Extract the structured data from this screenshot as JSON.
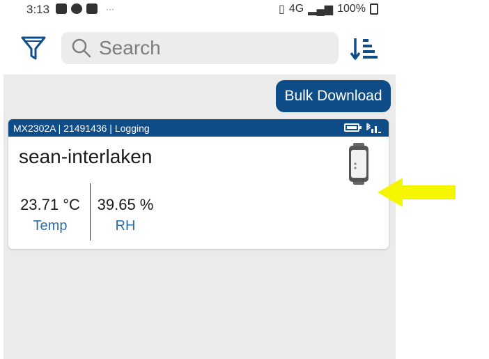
{
  "status_bar": {
    "time": "3:13",
    "network": "4G",
    "battery": "100%"
  },
  "search": {
    "placeholder": "Search"
  },
  "actions": {
    "bulk_download": "Bulk Download"
  },
  "device_card": {
    "header": "MX2302A | 21491436 | Logging",
    "name": "sean-interlaken",
    "readings": [
      {
        "value": "23.71 °C",
        "label": "Temp"
      },
      {
        "value": "39.65 %",
        "label": "RH"
      }
    ]
  },
  "colors": {
    "brand_blue": "#0f4d88",
    "label_blue": "#2f6ea5",
    "annotation_arrow": "#f5f500"
  },
  "icons": [
    "filter-icon",
    "search-icon",
    "sort-icon",
    "battery-icon",
    "bluetooth-signal-icon",
    "logger-device-icon",
    "arrow-annotation"
  ]
}
